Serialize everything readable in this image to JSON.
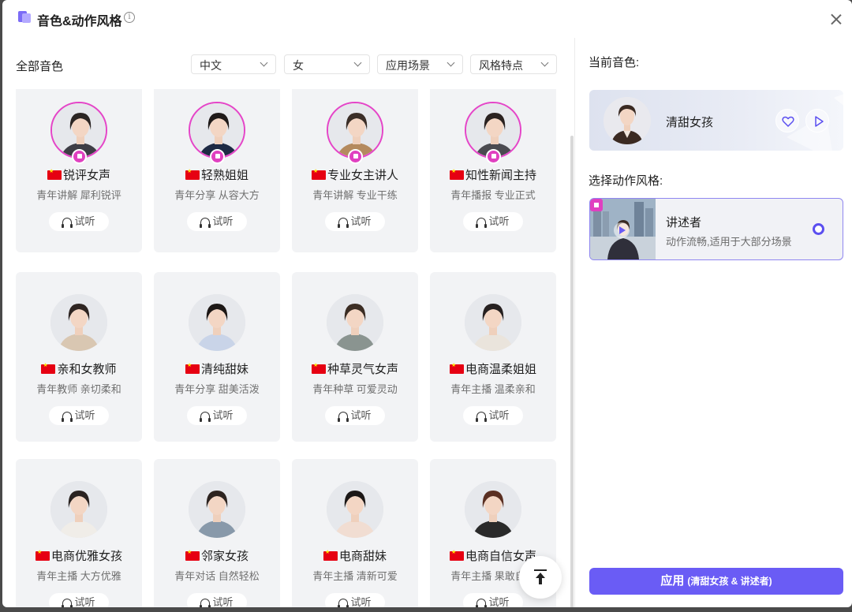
{
  "dialog": {
    "title": "音色&动作风格",
    "info_symbol": "i"
  },
  "voice_list": {
    "section_label": "全部音色",
    "filters": [
      {
        "value": "中文"
      },
      {
        "value": "女"
      },
      {
        "value": "应用场景"
      },
      {
        "value": "风格特点"
      }
    ],
    "listen_label": "试听",
    "cards": [
      {
        "name": "锐评女声",
        "tags": "青年讲解 犀利锐评",
        "featured": true
      },
      {
        "name": "轻熟姐姐",
        "tags": "青年分享 从容大方",
        "featured": true
      },
      {
        "name": "专业女主讲人",
        "tags": "青年讲解 专业干练",
        "featured": true
      },
      {
        "name": "知性新闻主持",
        "tags": "青年播报 专业正式",
        "featured": true
      },
      {
        "name": "亲和女教师",
        "tags": "青年教师 亲切柔和",
        "featured": false
      },
      {
        "name": "清纯甜妹",
        "tags": "青年分享 甜美活泼",
        "featured": false
      },
      {
        "name": "种草灵气女声",
        "tags": "青年种草 可爱灵动",
        "featured": false
      },
      {
        "name": "电商温柔姐姐",
        "tags": "青年主播 温柔亲和",
        "featured": false
      },
      {
        "name": "电商优雅女孩",
        "tags": "青年主播 大方优雅",
        "featured": false
      },
      {
        "name": "邻家女孩",
        "tags": "青年对话 自然轻松",
        "featured": false
      },
      {
        "name": "电商甜妹",
        "tags": "青年主播 清新可爱",
        "featured": false
      },
      {
        "name": "电商自信女声",
        "tags": "青年主播 果敢自信",
        "featured": false
      }
    ]
  },
  "current_voice": {
    "label": "当前音色:",
    "name": "清甜女孩"
  },
  "action_style": {
    "label": "选择动作风格:",
    "name": "讲述者",
    "description": "动作流畅,适用于大部分场景"
  },
  "apply_button": {
    "label": "应用",
    "detail": "(清甜女孩 & 讲述者)"
  },
  "colors": {
    "accent": "#6a5cf5",
    "featured_ring": "#e545c8",
    "card_bg": "#f2f3f5"
  }
}
